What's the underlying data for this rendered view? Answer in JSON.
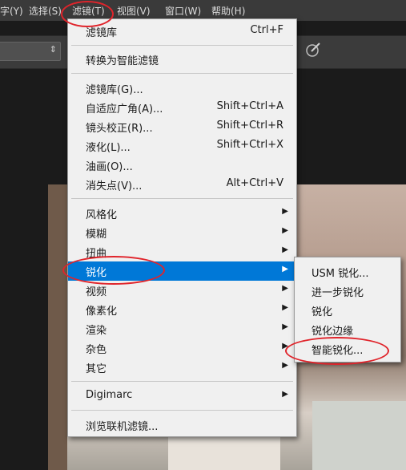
{
  "menubar": {
    "items": [
      "字(Y)",
      "选择(S)",
      "滤镜(T)",
      "视图(V)",
      "窗口(W)",
      "帮助(H)"
    ]
  },
  "filter_menu": {
    "items": [
      {
        "label": "滤镜库",
        "shortcut": "Ctrl+F"
      },
      {
        "label": "转换为智能滤镜"
      },
      {
        "label": "滤镜库(G)..."
      },
      {
        "label": "自适应广角(A)...",
        "shortcut": "Shift+Ctrl+A"
      },
      {
        "label": "镜头校正(R)...",
        "shortcut": "Shift+Ctrl+R"
      },
      {
        "label": "液化(L)...",
        "shortcut": "Shift+Ctrl+X"
      },
      {
        "label": "油画(O)..."
      },
      {
        "label": "消失点(V)...",
        "shortcut": "Alt+Ctrl+V"
      },
      {
        "label": "风格化"
      },
      {
        "label": "模糊"
      },
      {
        "label": "扭曲"
      },
      {
        "label": "锐化"
      },
      {
        "label": "视频"
      },
      {
        "label": "像素化"
      },
      {
        "label": "渲染"
      },
      {
        "label": "杂色"
      },
      {
        "label": "其它"
      },
      {
        "label": "Digimarc"
      },
      {
        "label": "浏览联机滤镜..."
      }
    ]
  },
  "sharpen_submenu": {
    "items": [
      "USM 锐化...",
      "进一步锐化",
      "锐化",
      "锐化边缘",
      "智能锐化..."
    ]
  },
  "icons": {
    "submenu_arrow": "triangle-right-icon",
    "combo_arrow": "updown-arrow-icon",
    "tool_option": "brush-icon"
  },
  "colors": {
    "highlight": "#0078d7",
    "annotation": "#e0242b",
    "menu_bg": "#f0f0f0"
  }
}
